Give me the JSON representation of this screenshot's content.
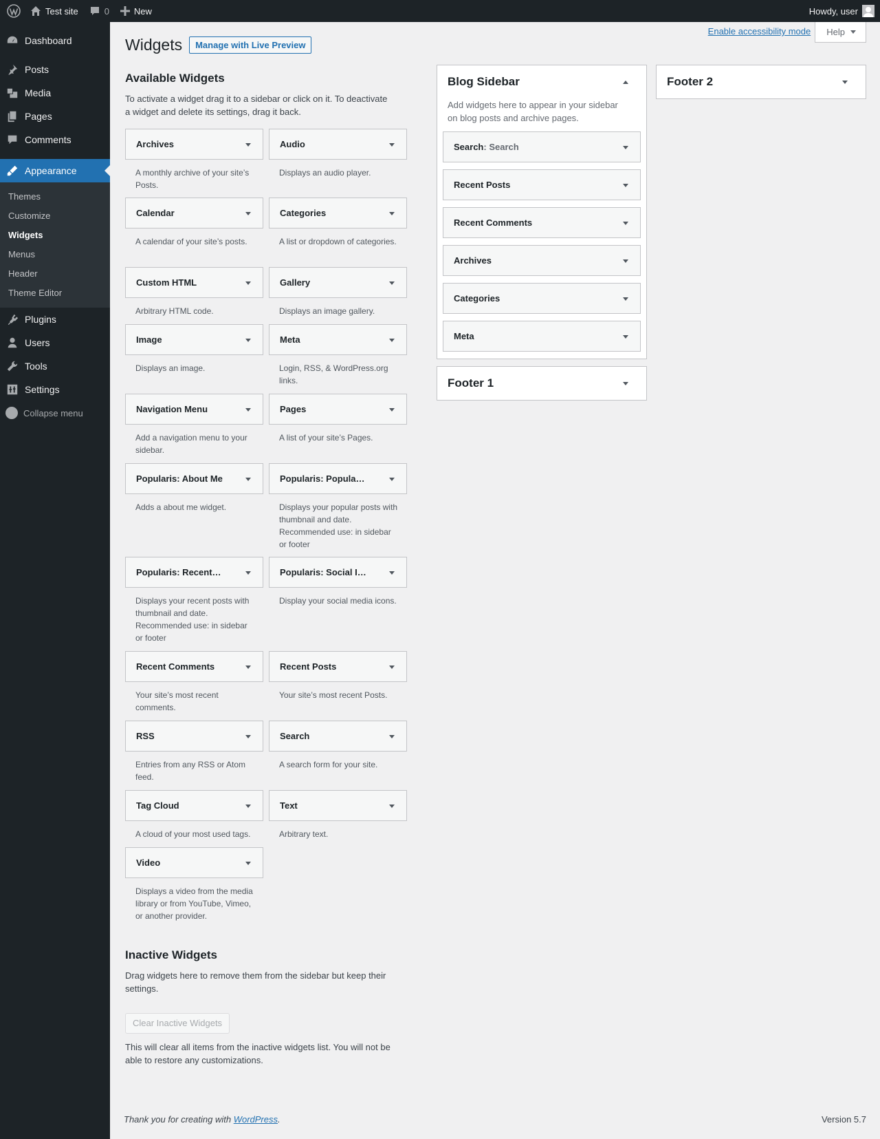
{
  "adminbar": {
    "site_name": "Test site",
    "comments_count": "0",
    "new_label": "New",
    "greeting": "Howdy, user"
  },
  "menu": {
    "items": [
      {
        "label": "Dashboard",
        "icon": "dashboard-icon"
      },
      {
        "label": "Posts",
        "icon": "pin-icon"
      },
      {
        "label": "Media",
        "icon": "media-icon"
      },
      {
        "label": "Pages",
        "icon": "pages-icon"
      },
      {
        "label": "Comments",
        "icon": "comment-icon"
      },
      {
        "label": "Appearance",
        "icon": "brush-icon"
      }
    ],
    "appearance_sub": [
      "Themes",
      "Customize",
      "Widgets",
      "Menus",
      "Header",
      "Theme Editor"
    ],
    "items_after": [
      {
        "label": "Plugins",
        "icon": "plugin-icon"
      },
      {
        "label": "Users",
        "icon": "user-icon"
      },
      {
        "label": "Tools",
        "icon": "wrench-icon"
      },
      {
        "label": "Settings",
        "icon": "settings-icon"
      }
    ],
    "collapse_label": "Collapse menu"
  },
  "header": {
    "accessibility_link": "Enable accessibility mode",
    "help_label": "Help",
    "title": "Widgets",
    "live_preview_label": "Manage with Live Preview"
  },
  "available": {
    "title": "Available Widgets",
    "description": "To activate a widget drag it to a sidebar or click on it. To deactivate a widget and delete its settings, drag it back.",
    "widgets": [
      {
        "name": "Archives",
        "desc": "A monthly archive of your site’s Posts."
      },
      {
        "name": "Audio",
        "desc": "Displays an audio player."
      },
      {
        "name": "Calendar",
        "desc": "A calendar of your site’s posts."
      },
      {
        "name": "Categories",
        "desc": "A list or dropdown of categories."
      },
      {
        "name": "Custom HTML",
        "desc": "Arbitrary HTML code."
      },
      {
        "name": "Gallery",
        "desc": "Displays an image gallery."
      },
      {
        "name": "Image",
        "desc": "Displays an image."
      },
      {
        "name": "Meta",
        "desc": "Login, RSS, & WordPress.org links."
      },
      {
        "name": "Navigation Menu",
        "desc": "Add a navigation menu to your sidebar."
      },
      {
        "name": "Pages",
        "desc": "A list of your site’s Pages."
      },
      {
        "name": "Popularis: About Me",
        "desc": "Adds a about me widget."
      },
      {
        "name": "Popularis: Popula…",
        "desc": "Displays your popular posts with thumbnail and date. Recommended use: in sidebar or footer"
      },
      {
        "name": "Popularis: Recent…",
        "desc": "Displays your recent posts with thumbnail and date. Recommended use: in sidebar or footer"
      },
      {
        "name": "Popularis: Social I…",
        "desc": "Display your social media icons."
      },
      {
        "name": "Recent Comments",
        "desc": "Your site’s most recent comments."
      },
      {
        "name": "Recent Posts",
        "desc": "Your site’s most recent Posts."
      },
      {
        "name": "RSS",
        "desc": "Entries from any RSS or Atom feed."
      },
      {
        "name": "Search",
        "desc": "A search form for your site."
      },
      {
        "name": "Tag Cloud",
        "desc": "A cloud of your most used tags."
      },
      {
        "name": "Text",
        "desc": "Arbitrary text."
      },
      {
        "name": "Video",
        "desc": "Displays a video from the media library or from YouTube, Vimeo, or another provider."
      }
    ]
  },
  "blog_sidebar": {
    "title": "Blog Sidebar",
    "description": "Add widgets here to appear in your sidebar on blog posts and archive pages.",
    "widgets": [
      {
        "name": "Search",
        "sub": ": Search"
      },
      {
        "name": "Recent Posts",
        "sub": ""
      },
      {
        "name": "Recent Comments",
        "sub": ""
      },
      {
        "name": "Archives",
        "sub": ""
      },
      {
        "name": "Categories",
        "sub": ""
      },
      {
        "name": "Meta",
        "sub": ""
      }
    ]
  },
  "footer1": {
    "title": "Footer 1"
  },
  "footer2": {
    "title": "Footer 2"
  },
  "inactive": {
    "title": "Inactive Widgets",
    "description": "Drag widgets here to remove them from the sidebar but keep their settings.",
    "clear_label": "Clear Inactive Widgets",
    "clear_note": "This will clear all items from the inactive widgets list. You will not be able to restore any customizations."
  },
  "footer": {
    "thanks_prefix": "Thank you for creating with ",
    "wordpress_link": "WordPress",
    "thanks_suffix": ".",
    "version": "Version 5.7"
  }
}
